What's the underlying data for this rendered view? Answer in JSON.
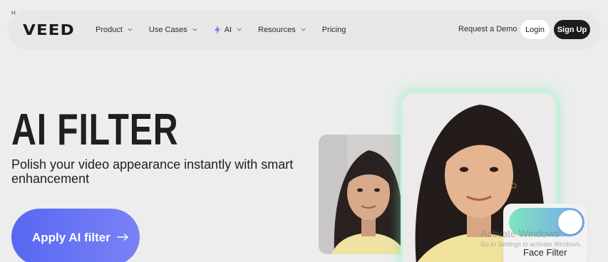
{
  "corner_mark": "H",
  "nav": {
    "logo": "VEED",
    "menu": [
      {
        "label": "Product",
        "has_dropdown": true,
        "icon": "chevron-down-icon"
      },
      {
        "label": "Use Cases",
        "has_dropdown": true,
        "icon": "chevron-down-icon"
      },
      {
        "label": "AI",
        "has_dropdown": true,
        "icon": "chevron-down-icon",
        "lead_icon": "lightning-bolt-icon"
      },
      {
        "label": "Resources",
        "has_dropdown": true,
        "icon": "chevron-down-icon"
      },
      {
        "label": "Pricing",
        "has_dropdown": false
      }
    ],
    "demo_label": "Request a Demo",
    "login_label": "Login",
    "signup_label": "Sign Up"
  },
  "hero": {
    "title": "AI FILTER",
    "subtitle": "Polish your video appearance instantly with smart enhancement",
    "cta_label": "Apply AI filter",
    "cta_icon": "arrow-right-icon"
  },
  "preview": {
    "toggle_label": "Face Filter",
    "toggle_on": true
  },
  "watermark": {
    "title": "Activate Windows",
    "subtitle": "Go to Settings to activate Windows."
  },
  "colors": {
    "page_bg": "#eceeed",
    "cta_start": "#5867f2",
    "cta_end": "#7a82f6",
    "glow": "#70e8ac",
    "bolt": "#8b6cf2",
    "signup_bg": "#1c1c1c"
  }
}
